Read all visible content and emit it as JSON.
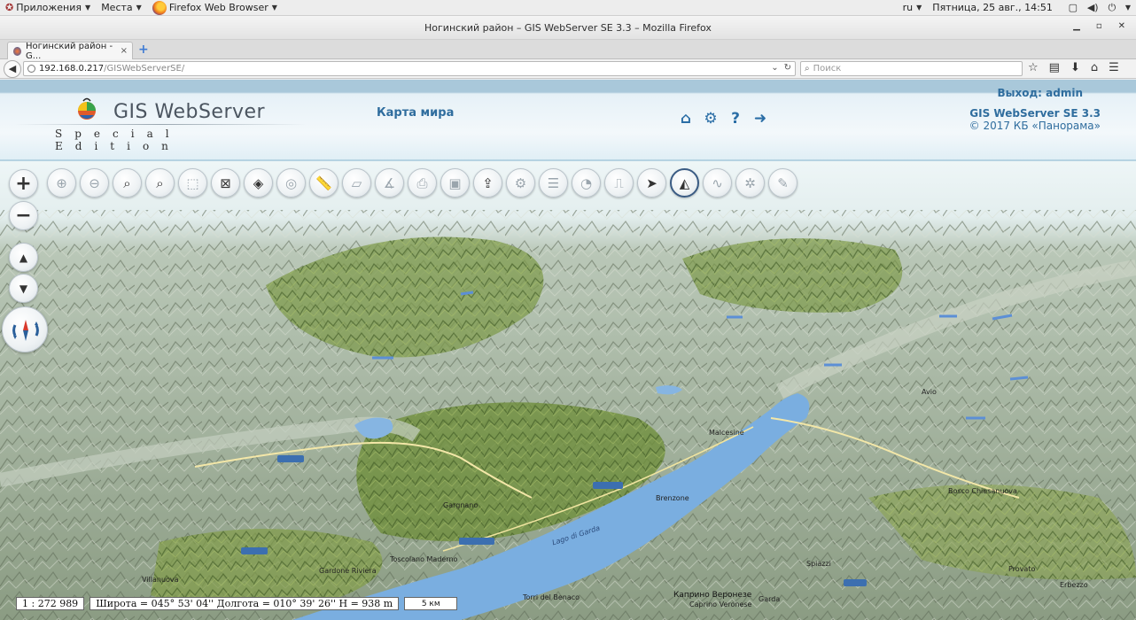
{
  "gnome": {
    "apps": "Приложения",
    "places": "Места",
    "browser": "Firefox Web Browser",
    "lang": "ru",
    "clock": "Пятница, 25 авг., 14:51"
  },
  "window": {
    "title": "Ногинский район – GIS WebServer SE 3.3 – Mozilla Firefox"
  },
  "tab": {
    "title": "Ногинский район - G...",
    "close": "×",
    "new": "+"
  },
  "nav": {
    "url_host": "192.168.0.217",
    "url_path": "/GISWebServerSE/",
    "search_placeholder": "Поиск"
  },
  "app": {
    "logo_text": "GIS WebServer",
    "logo_sub": "Special Edition",
    "map_title": "Карта мира",
    "logout": "Выход: admin",
    "version": "GIS WebServer SE 3.3",
    "copyright": "© 2017 КБ «Панорама»"
  },
  "toolbar": {
    "tools": [
      {
        "name": "zoom-in-area",
        "icon": "zoom-in-icon",
        "glyph": "⊕",
        "dark": false
      },
      {
        "name": "zoom-out-area",
        "icon": "zoom-out-icon",
        "glyph": "⊖",
        "dark": false
      },
      {
        "name": "search",
        "icon": "search-icon",
        "glyph": "⌕",
        "dark": true
      },
      {
        "name": "search-list",
        "icon": "search-list-icon",
        "glyph": "⌕",
        "dark": true
      },
      {
        "name": "area-search",
        "icon": "area-search-icon",
        "glyph": "⬚",
        "dark": false
      },
      {
        "name": "clear-selection",
        "icon": "clear-selection-icon",
        "glyph": "⊠",
        "dark": true
      },
      {
        "name": "layers",
        "icon": "layers-icon",
        "glyph": "◈",
        "dark": true
      },
      {
        "name": "legend",
        "icon": "legend-icon",
        "glyph": "◎",
        "dark": false
      },
      {
        "name": "ruler",
        "icon": "ruler-icon",
        "glyph": "📏",
        "dark": false
      },
      {
        "name": "area-measure",
        "icon": "area-measure-icon",
        "glyph": "▱",
        "dark": false
      },
      {
        "name": "angle-measure",
        "icon": "angle-icon",
        "glyph": "∡",
        "dark": false
      },
      {
        "name": "print",
        "icon": "print-icon",
        "glyph": "⎙",
        "dark": false
      },
      {
        "name": "export-image",
        "icon": "export-image-icon",
        "glyph": "▣",
        "dark": false
      },
      {
        "name": "share",
        "icon": "share-icon",
        "glyph": "⇪",
        "dark": true
      },
      {
        "name": "settings",
        "icon": "settings-icon",
        "glyph": "⚙",
        "dark": false
      },
      {
        "name": "list",
        "icon": "list-icon",
        "glyph": "☰",
        "dark": false
      },
      {
        "name": "pie",
        "icon": "pie-chart-icon",
        "glyph": "◔",
        "dark": false
      },
      {
        "name": "stamp",
        "icon": "stamp-icon",
        "glyph": "⎍",
        "dark": false
      },
      {
        "name": "send",
        "icon": "send-icon",
        "glyph": "➤",
        "dark": true
      },
      {
        "name": "3d-view",
        "icon": "shapes-icon",
        "glyph": "◭",
        "dark": true,
        "active": true
      },
      {
        "name": "route",
        "icon": "route-icon",
        "glyph": "∿",
        "dark": false
      },
      {
        "name": "graph",
        "icon": "graph-icon",
        "glyph": "✲",
        "dark": false
      },
      {
        "name": "edit",
        "icon": "pencil-icon",
        "glyph": "✎",
        "dark": false
      }
    ]
  },
  "left_controls": {
    "zoom_in": "+",
    "zoom_out": "−",
    "tilt_up": "▲",
    "tilt_down": "▼"
  },
  "status": {
    "scale": "1 : 272 989",
    "coords": "Широта = 045° 53' 04'' Долгота = 010° 39' 26'' H = 938 m",
    "scale_bar": "5 км"
  },
  "map_labels": [
    {
      "text": "Lago di Garda"
    },
    {
      "text": "Garda"
    },
    {
      "text": "Torri del Benaco"
    },
    {
      "text": "Каприно Веронезе"
    },
    {
      "text": "Caprino Veronese"
    },
    {
      "text": "Gardone Riviera"
    },
    {
      "text": "Toscolano Maderno"
    },
    {
      "text": "Brenzone"
    },
    {
      "text": "Malcesine"
    },
    {
      "text": "Avio"
    },
    {
      "text": "Villanuova"
    },
    {
      "text": "Gargnano"
    },
    {
      "text": "Spiazzi"
    },
    {
      "text": "Provato"
    },
    {
      "text": "Erbezzo"
    },
    {
      "text": "Bosco Chiesanuova"
    }
  ]
}
